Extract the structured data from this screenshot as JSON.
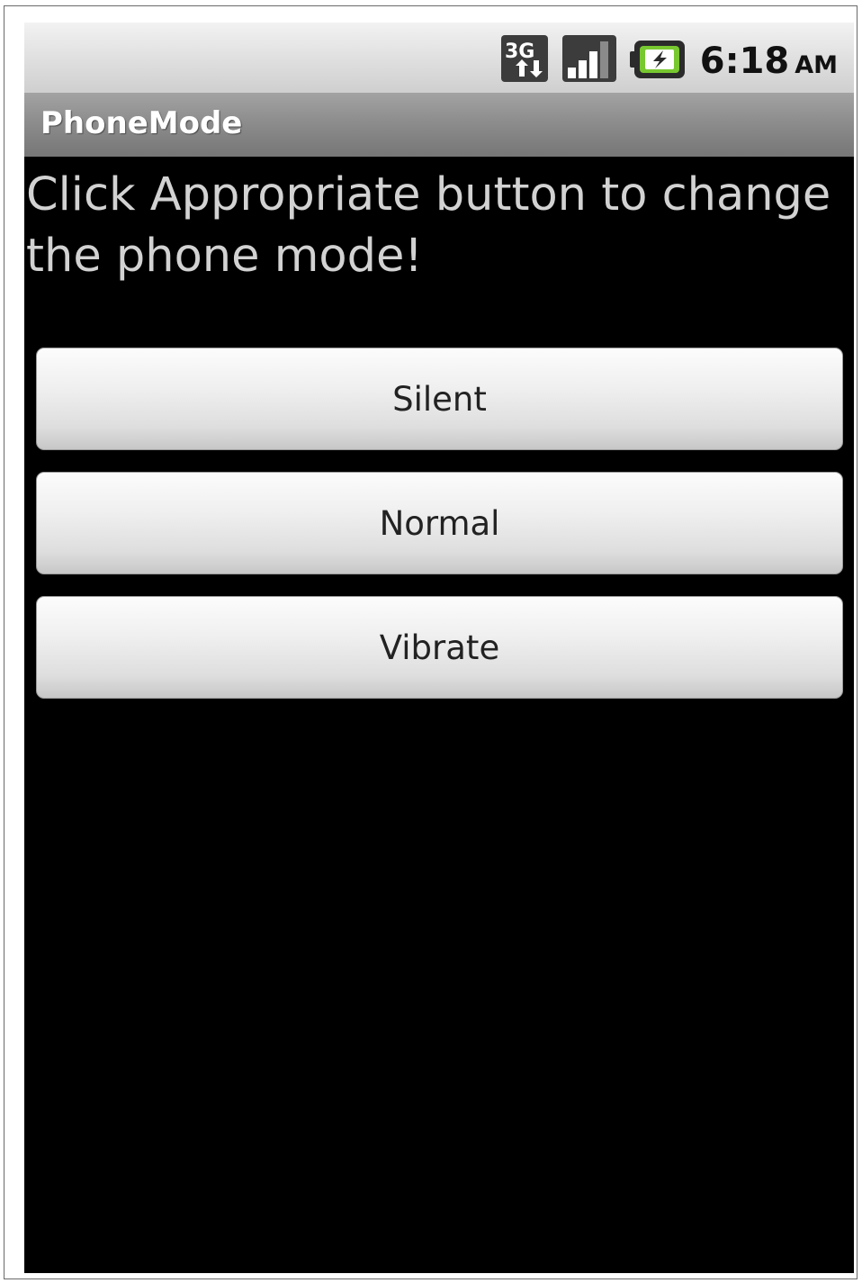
{
  "status_bar": {
    "network_label": "3G",
    "network_icon": "3g-data-icon",
    "signal_icon": "signal-strength-icon",
    "signal_level": 0.75,
    "battery_icon": "battery-charging-icon",
    "time": "6:18",
    "ampm": "AM"
  },
  "app": {
    "title": "PhoneMode"
  },
  "main": {
    "instruction": "Click Appropriate button to change the phone mode!",
    "buttons": [
      {
        "label": "Silent"
      },
      {
        "label": "Normal"
      },
      {
        "label": "Vibrate"
      }
    ]
  },
  "colors": {
    "screen_background": "#000000",
    "instruction_text": "#d2d2d2",
    "title_bar": "#8d8d8d",
    "battery_charge": "#78c830"
  }
}
